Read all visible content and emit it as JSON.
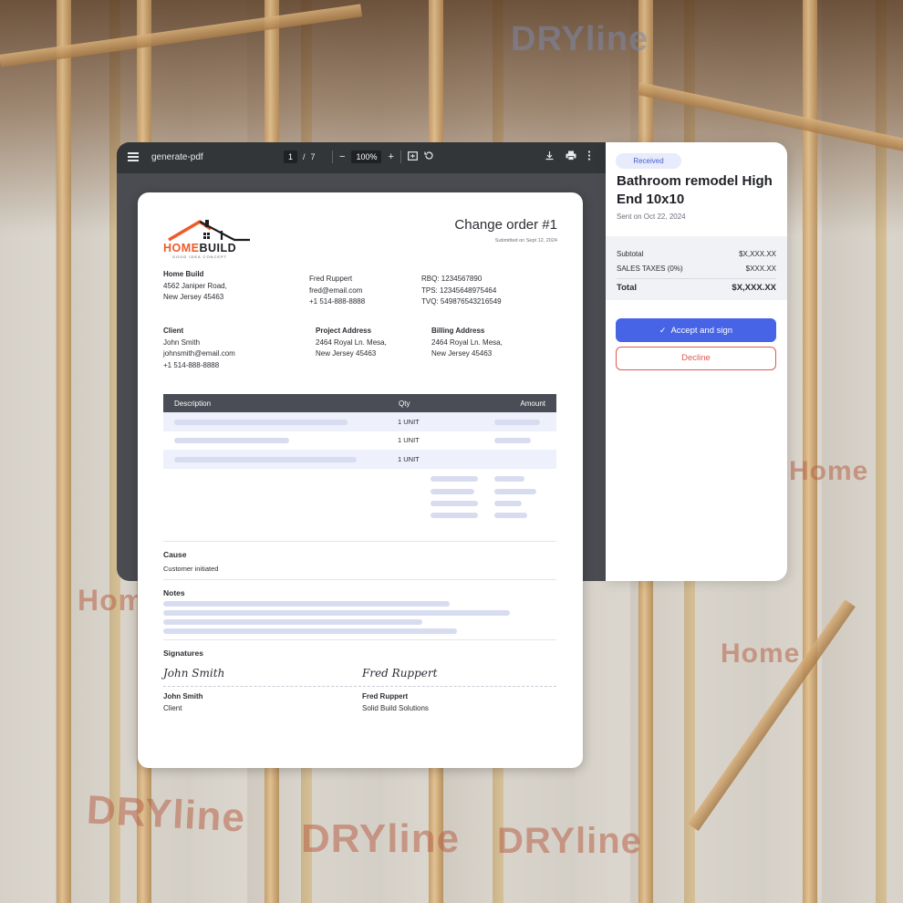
{
  "viewer": {
    "filename": "generate-pdf",
    "page_current": "1",
    "page_total": "7",
    "zoom": "100%"
  },
  "document": {
    "logo": {
      "word_left": "HOME",
      "word_right": "BUILD",
      "tagline": "GOOD IDEA CONCEPT"
    },
    "title": "Change order #1",
    "submitted": "Submitted on Sept 12, 2024",
    "company": {
      "name": "Home Build",
      "address1": "4562 Janiper Road,",
      "address2": "New Jersey 45463"
    },
    "contact": {
      "name": "Fred Ruppert",
      "email": "fred@email.com",
      "phone": "+1 514-888-8888"
    },
    "tax_ids": {
      "rbq": "RBQ: 1234567890",
      "tps": "TPS: 12345648975464",
      "tvq": "TVQ: 549876543216549"
    },
    "client": {
      "label": "Client",
      "name": "John Smith",
      "email": "johnsmith@email.com",
      "phone": "+1 514-888-8888"
    },
    "project_address": {
      "label": "Project Address",
      "line1": "2464 Royal Ln. Mesa,",
      "line2": "New Jersey 45463"
    },
    "billing_address": {
      "label": "Billing Address",
      "line1": "2464 Royal Ln. Mesa,",
      "line2": "New Jersey 45463"
    },
    "table": {
      "headers": {
        "description": "Description",
        "qty": "Qty",
        "amount": "Amount"
      },
      "rows": [
        {
          "qty": "1 UNIT"
        },
        {
          "qty": "1 UNIT"
        },
        {
          "qty": "1 UNIT"
        }
      ]
    },
    "cause": {
      "label": "Cause",
      "value": "Customer initiated"
    },
    "notes": {
      "label": "Notes"
    },
    "signatures": {
      "label": "Signatures",
      "left": {
        "signature": "John Smith",
        "name": "John Smith",
        "role": "Client"
      },
      "right": {
        "signature": "Fred Ruppert",
        "name": "Fred Ruppert",
        "role": "Solid Build Solutions"
      }
    }
  },
  "panel": {
    "status": "Received",
    "title": "Bathroom remodel High End 10x10",
    "sent": "Sent on Oct 22, 2024",
    "subtotal_label": "Subtotal",
    "subtotal_value": "$X,XXX.XX",
    "tax_label": "SALES TAXES (0%)",
    "tax_value": "$XXX.XX",
    "total_label": "Total",
    "total_value": "$X,XXX.XX",
    "accept_label": "Accept and sign",
    "decline_label": "Decline"
  },
  "background": {
    "brand_dry": "DRYline",
    "brand_home": "Home"
  },
  "colors": {
    "accent": "#4864e6",
    "decline": "#e05757",
    "logo_orange": "#f05a28",
    "table_header": "#4a4c56"
  }
}
